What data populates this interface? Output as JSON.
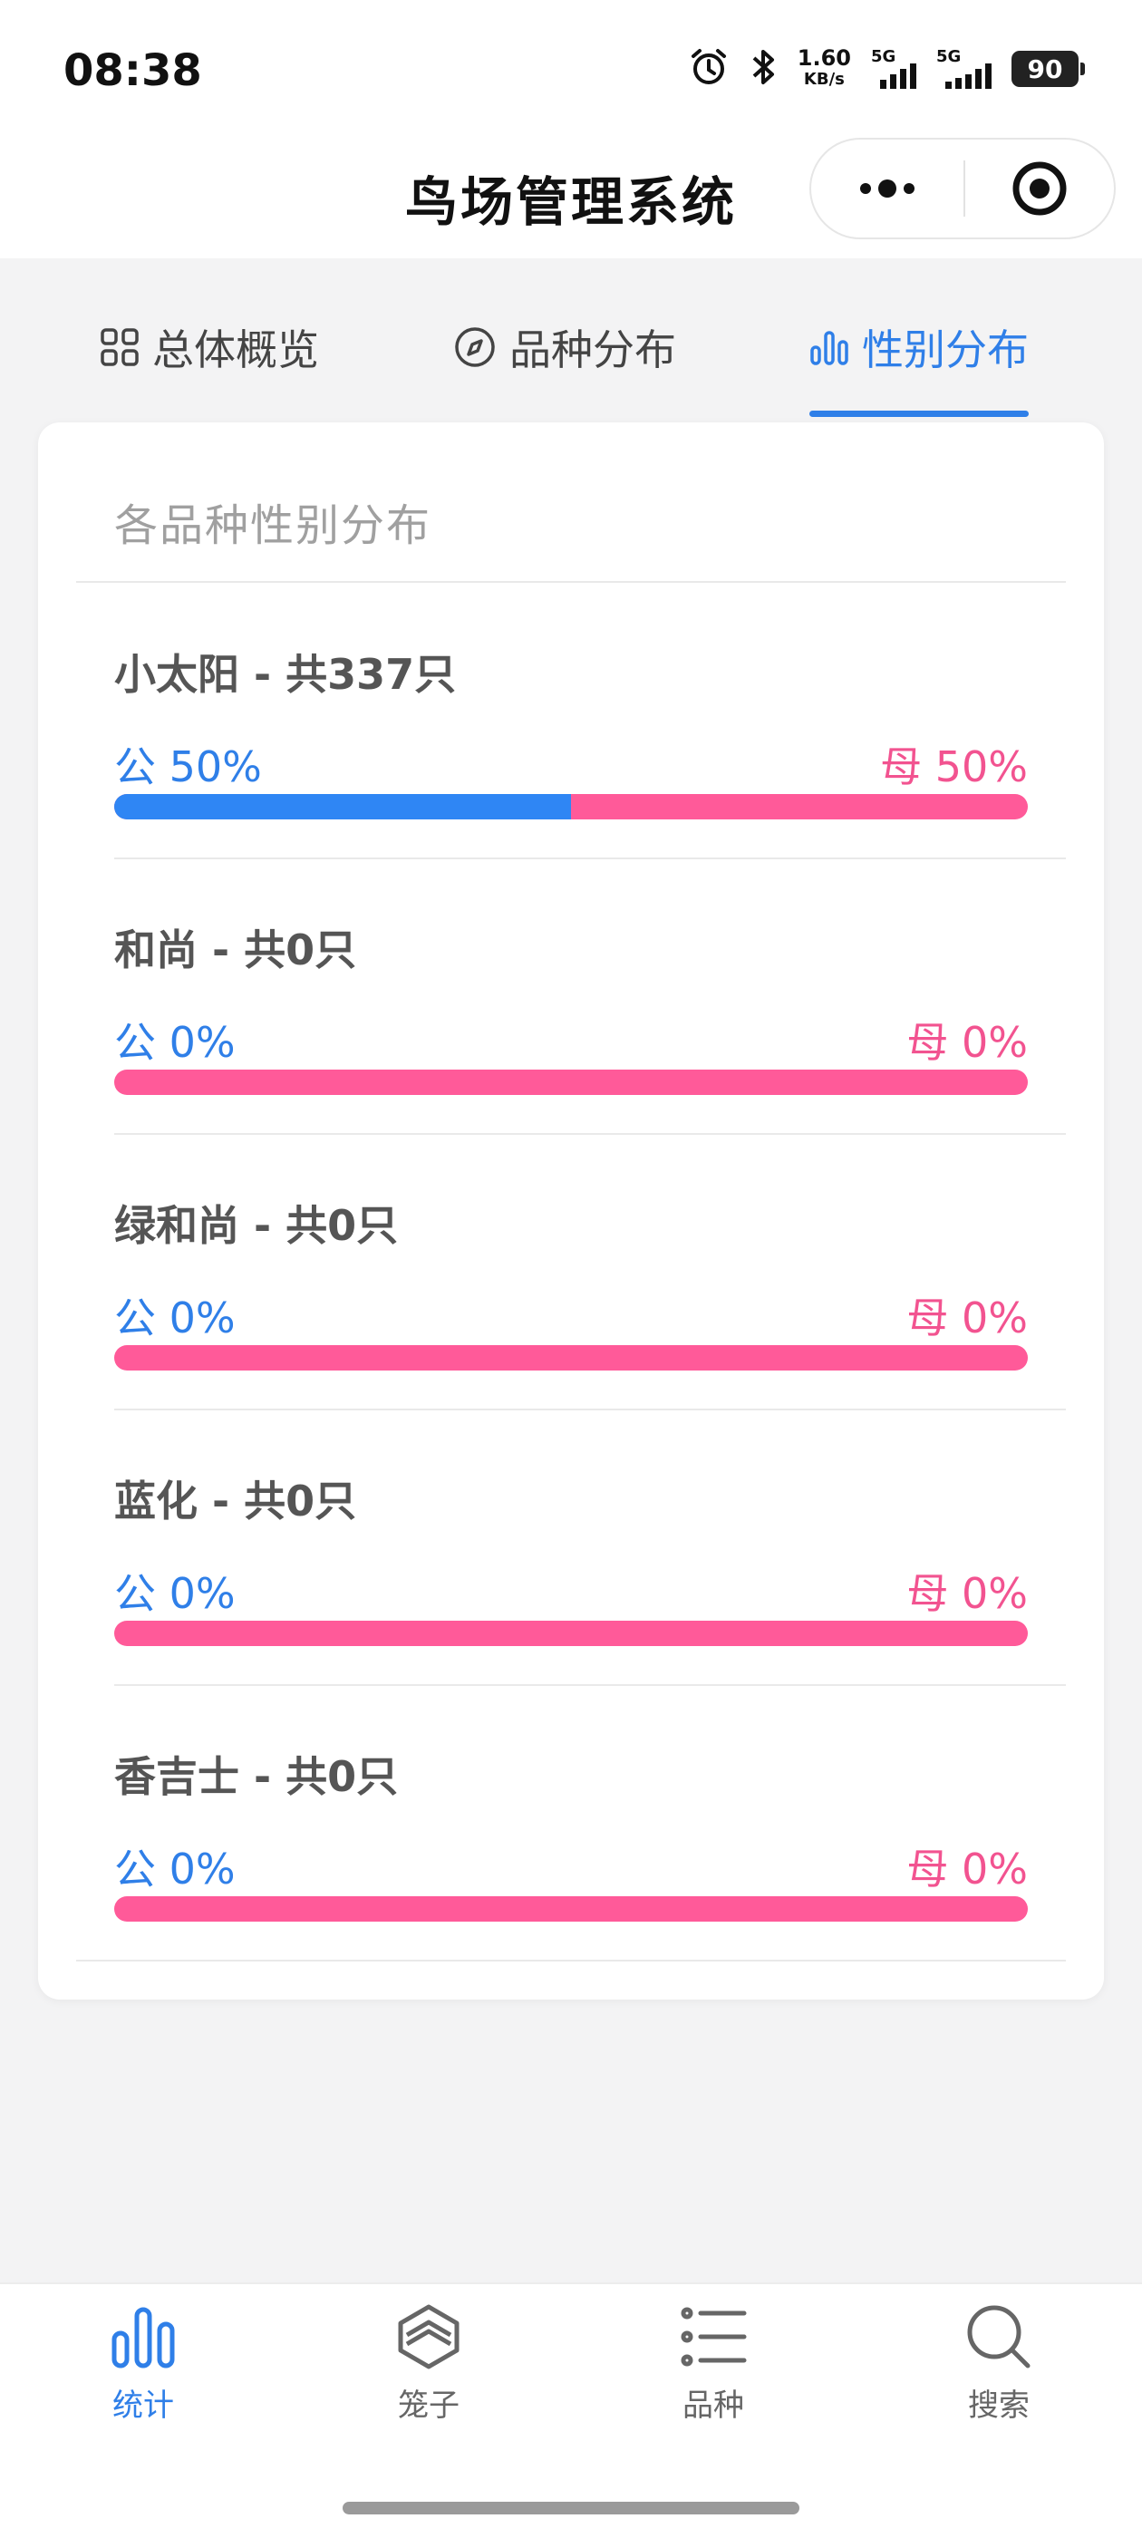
{
  "status_bar": {
    "time": "08:38",
    "net_speed_value": "1.60",
    "net_speed_unit": "KB/s",
    "signal_1_label": "5G",
    "signal_2_label": "5G",
    "battery": "90"
  },
  "header": {
    "title": "鸟场管理系统"
  },
  "tabs": [
    {
      "label": "总体概览",
      "icon": "grid-icon"
    },
    {
      "label": "品种分布",
      "icon": "compass-icon"
    },
    {
      "label": "性别分布",
      "icon": "bar-chart-icon",
      "active": true
    }
  ],
  "card": {
    "title": "各品种性别分布",
    "rows": [
      {
        "title": "小太阳 - 共337只",
        "male_label": "公 50%",
        "female_label": "母 50%",
        "male_ratio": 0.5
      },
      {
        "title": "和尚 - 共0只",
        "male_label": "公 0%",
        "female_label": "母 0%",
        "male_ratio": 0
      },
      {
        "title": "绿和尚 - 共0只",
        "male_label": "公 0%",
        "female_label": "母 0%",
        "male_ratio": 0
      },
      {
        "title": "蓝化 - 共0只",
        "male_label": "公 0%",
        "female_label": "母 0%",
        "male_ratio": 0
      },
      {
        "title": "香吉士 - 共0只",
        "male_label": "公 0%",
        "female_label": "母 0%",
        "male_ratio": 0
      }
    ]
  },
  "bottom_nav": [
    {
      "label": "统计",
      "icon": "stats-icon",
      "active": true
    },
    {
      "label": "笼子",
      "icon": "cage-icon"
    },
    {
      "label": "品种",
      "icon": "list-icon"
    },
    {
      "label": "搜索",
      "icon": "search-icon"
    }
  ],
  "colors": {
    "accent": "#2f7fe8",
    "male": "#2f86f4",
    "female": "#ff5a99"
  }
}
